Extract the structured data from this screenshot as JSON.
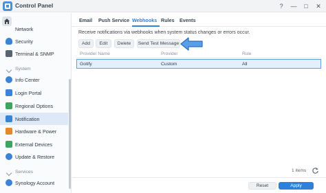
{
  "window": {
    "title": "Control Panel",
    "help_icon": "?",
    "minimize_icon": "—",
    "maximize_icon": "□",
    "close_icon": "✕"
  },
  "sidebar": {
    "items": [
      {
        "label": "Network",
        "icon": "network-icon",
        "color": "#4e8fd6"
      },
      {
        "label": "Security",
        "icon": "shield-icon",
        "color": "#3b83d4"
      },
      {
        "label": "Terminal & SNMP",
        "icon": "terminal-icon",
        "color": "#5a6470"
      },
      {
        "label": "Info Center",
        "icon": "info-icon",
        "color": "#3b83d4"
      },
      {
        "label": "Login Portal",
        "icon": "login-portal-icon",
        "color": "#3b83d4"
      },
      {
        "label": "Regional Options",
        "icon": "regional-icon",
        "color": "#3fa460"
      },
      {
        "label": "Notification",
        "icon": "notification-icon",
        "color": "#3b83d4"
      },
      {
        "label": "Hardware & Power",
        "icon": "power-icon",
        "color": "#e08a2c"
      },
      {
        "label": "External Devices",
        "icon": "external-devices-icon",
        "color": "#3fa460"
      },
      {
        "label": "Update & Restore",
        "icon": "update-icon",
        "color": "#3b83d4"
      },
      {
        "label": "Synology Account",
        "icon": "account-icon",
        "color": "#3b83d4"
      }
    ],
    "sections": {
      "system": "System",
      "services": "Services"
    }
  },
  "tabs": [
    "Email",
    "Push Service",
    "Webhooks",
    "Rules",
    "Events"
  ],
  "active_tab": "Webhooks",
  "main": {
    "description": "Receive notifications via webhooks when system status changes or errors occur.",
    "toolbar": {
      "add": "Add",
      "edit": "Edit",
      "delete": "Delete",
      "send_test": "Send Test Message"
    },
    "table": {
      "columns": [
        "Provider Name",
        "Provider",
        "Rule"
      ],
      "rows": [
        {
          "name": "Gotify",
          "provider": "Custom",
          "rule": "All"
        }
      ]
    },
    "items_count": "1 items"
  },
  "footer": {
    "reset": "Reset",
    "apply": "Apply"
  },
  "colors": {
    "accent": "#2f80d8",
    "arrow": "#5b9ee8"
  }
}
